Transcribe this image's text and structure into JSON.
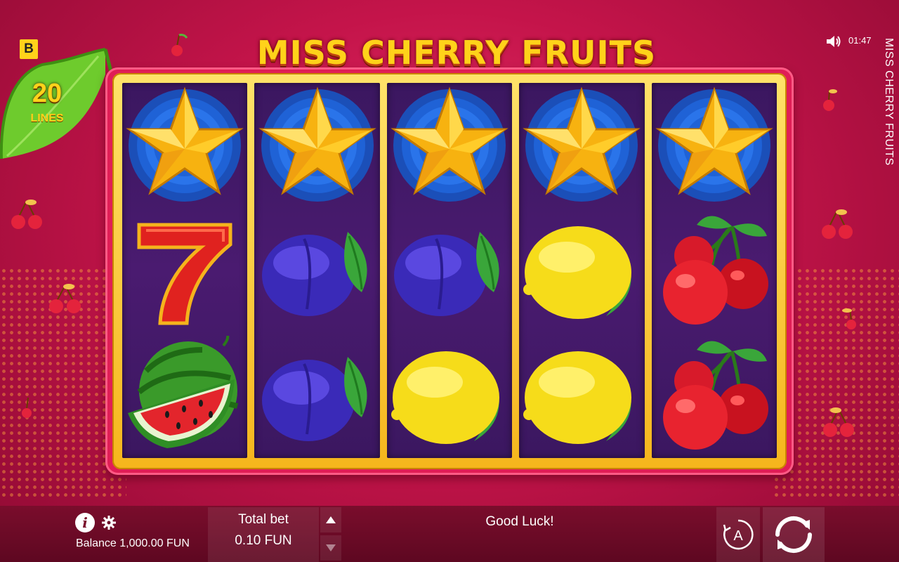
{
  "brand": {
    "logo_letter": "B"
  },
  "lines": {
    "count": "20",
    "label": "LINES"
  },
  "game": {
    "title": "MISS CHERRY FRUITS",
    "side_title": "MISS CHERRY FRUITS"
  },
  "status": {
    "time": "01:47",
    "sound_icon": "speaker-icon"
  },
  "reels": [
    [
      "star",
      "seven",
      "watermelon"
    ],
    [
      "star",
      "plum",
      "plum"
    ],
    [
      "star",
      "plum",
      "lemon"
    ],
    [
      "star",
      "lemon",
      "lemon"
    ],
    [
      "star",
      "cherry",
      "cherry"
    ]
  ],
  "bottom": {
    "balance_label": "Balance 1,000.00 FUN",
    "total_bet_label": "Total bet",
    "total_bet_value": "0.10 FUN",
    "message": "Good Luck!",
    "info_glyph": "i",
    "auto_label": "A"
  },
  "colors": {
    "background": "#c4144a",
    "reel_frame_gold": "#f6b51c",
    "reel_bg": "#3b1760",
    "accent_yellow": "#ffd21a"
  }
}
